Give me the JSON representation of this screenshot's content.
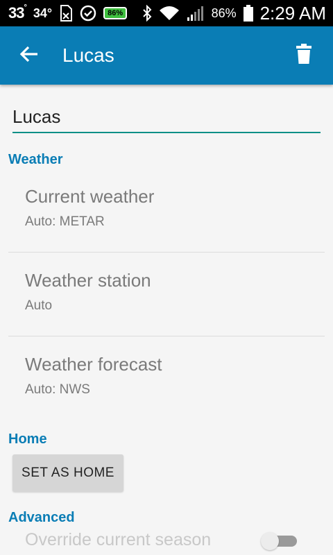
{
  "status_bar": {
    "temp1": "33",
    "temp1_unit": "°",
    "temp2": "34°",
    "battery_badge": "86%",
    "battery_pct": "86%",
    "time": "2:29 AM"
  },
  "app_bar": {
    "title": "Lucas",
    "back_icon": "arrow-left-icon",
    "delete_icon": "trash-icon"
  },
  "name_field": {
    "value": "Lucas"
  },
  "sections": {
    "weather": {
      "header": "Weather",
      "items": [
        {
          "title": "Current weather",
          "summary": "Auto: METAR"
        },
        {
          "title": "Weather station",
          "summary": "Auto"
        },
        {
          "title": "Weather forecast",
          "summary": "Auto: NWS"
        }
      ]
    },
    "home": {
      "header": "Home",
      "button_label": "SET AS HOME"
    },
    "advanced": {
      "header": "Advanced",
      "override_label": "Override current season",
      "override_on": false
    }
  },
  "colors": {
    "accent": "#0a7db5",
    "underline": "#0a8f87",
    "status_bar": "#000000"
  }
}
